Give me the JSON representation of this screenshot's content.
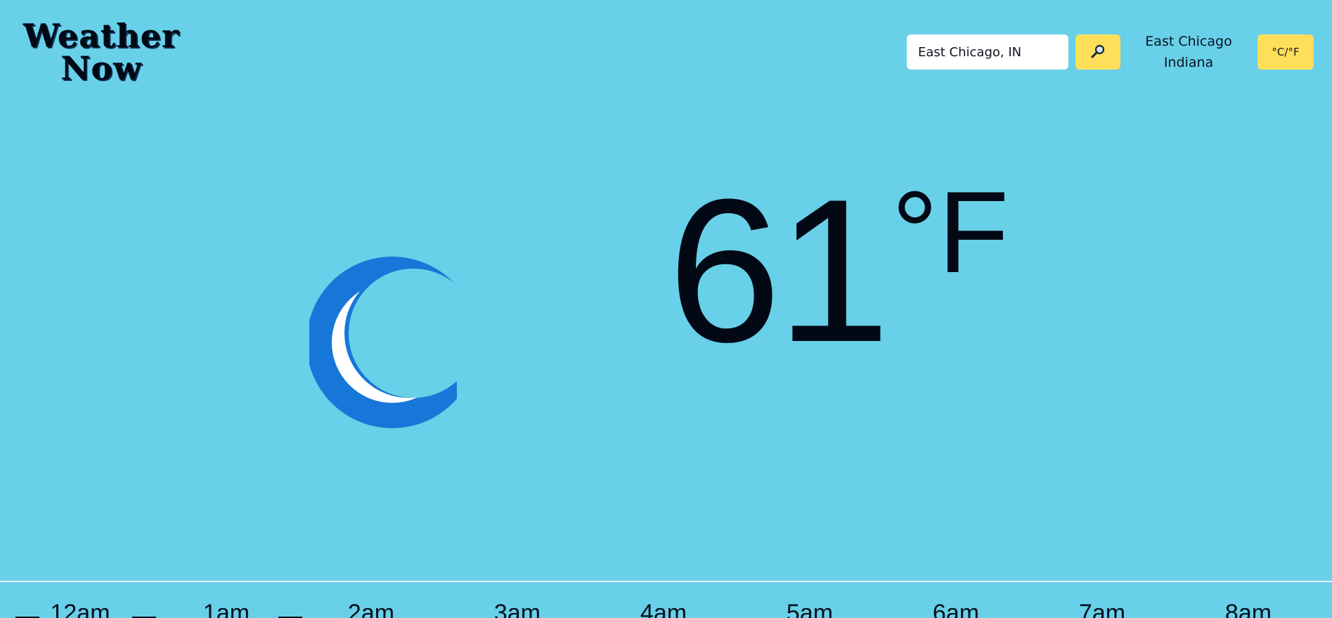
{
  "logo": {
    "line1": "Weather",
    "line2": "Now"
  },
  "search": {
    "value": "East Chicago, IN",
    "button_icon": "magnifying-glass-icon"
  },
  "location": {
    "city": "East Chicago",
    "state": "Indiana"
  },
  "unit_toggle_label": "°C/°F",
  "current": {
    "icon": "crescent-moon-icon",
    "temperature": "61",
    "unit": "°F"
  },
  "hourly": [
    {
      "time": "12am"
    },
    {
      "time": "1am"
    },
    {
      "time": "2am"
    },
    {
      "time": "3am"
    },
    {
      "time": "4am"
    },
    {
      "time": "5am"
    },
    {
      "time": "6am"
    },
    {
      "time": "7am"
    },
    {
      "time": "8am"
    }
  ],
  "colors": {
    "background": "#68d0e8",
    "accent": "#ffdf5a",
    "moon_outer": "#1677d8",
    "moon_inner": "#ffffff"
  }
}
